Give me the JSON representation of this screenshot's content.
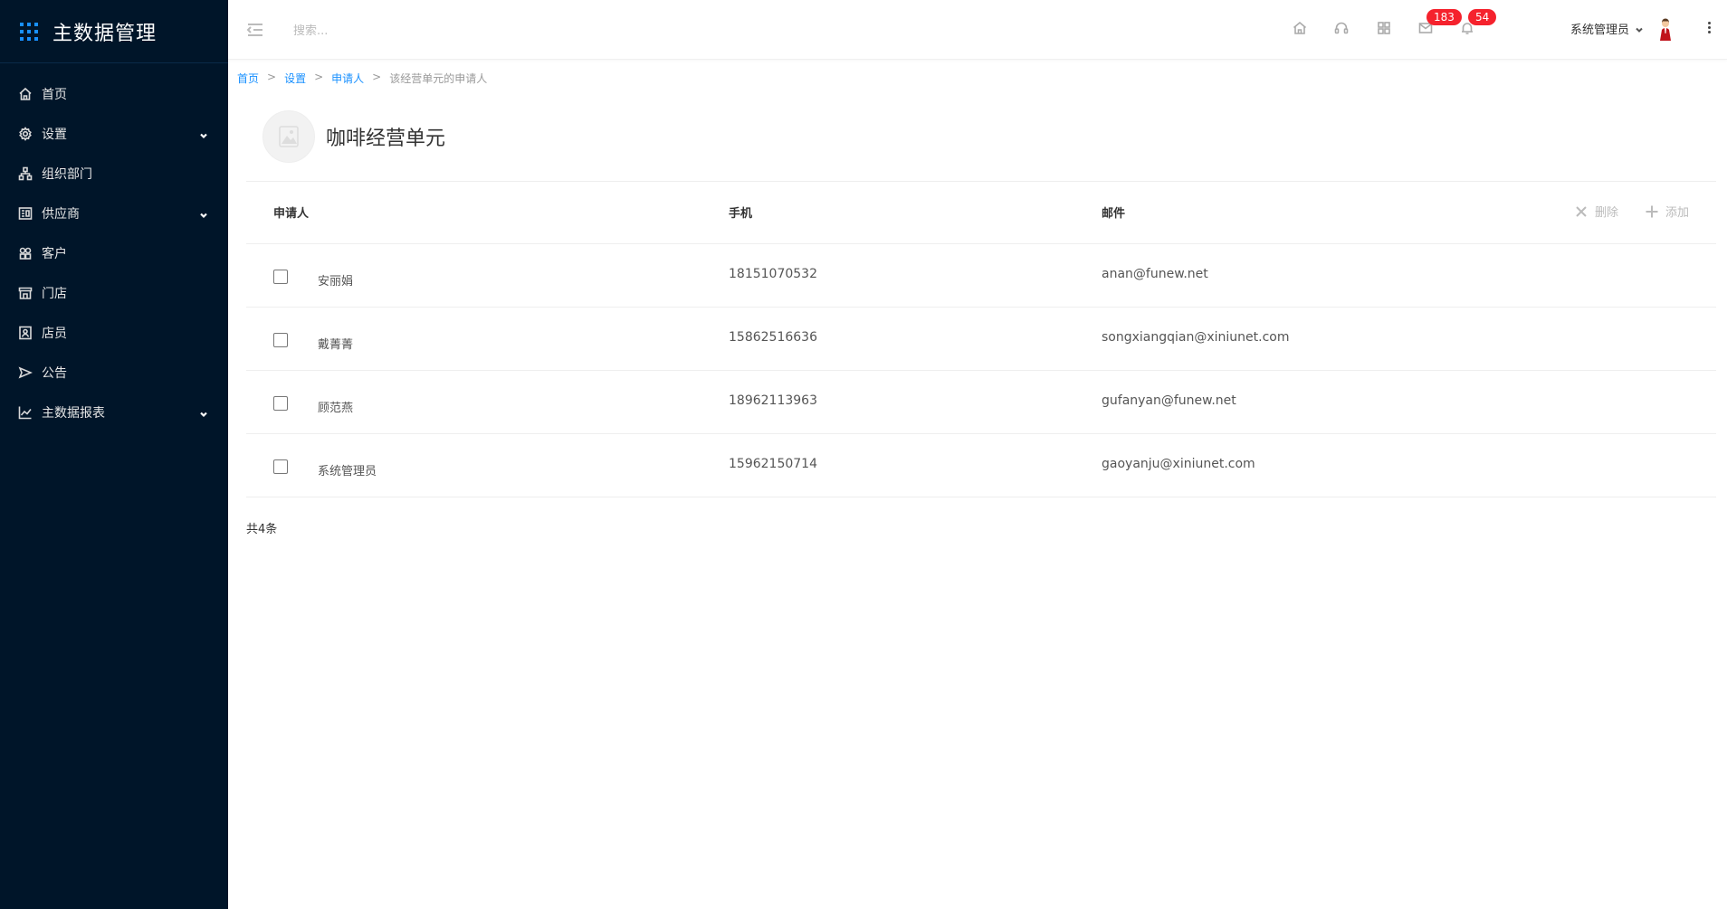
{
  "app": {
    "title": "主数据管理"
  },
  "sidebar": {
    "items": [
      {
        "label": "首页",
        "icon": "home-icon",
        "has_children": false
      },
      {
        "label": "设置",
        "icon": "gear-icon",
        "has_children": true
      },
      {
        "label": "组织部门",
        "icon": "org-tree-icon",
        "has_children": false
      },
      {
        "label": "供应商",
        "icon": "supplier-icon",
        "has_children": true
      },
      {
        "label": "客户",
        "icon": "customer-icon",
        "has_children": false
      },
      {
        "label": "门店",
        "icon": "store-icon",
        "has_children": false
      },
      {
        "label": "店员",
        "icon": "staff-icon",
        "has_children": false
      },
      {
        "label": "公告",
        "icon": "announcement-icon",
        "has_children": false
      },
      {
        "label": "主数据报表",
        "icon": "chart-icon",
        "has_children": true
      }
    ]
  },
  "header": {
    "search_placeholder": "搜索...",
    "icons": [
      "home-icon",
      "headset-icon",
      "apps-icon",
      "mail-icon",
      "bell-icon"
    ],
    "mail_badge": "183",
    "bell_badge": "54",
    "user_name": "系统管理员"
  },
  "breadcrumb": {
    "items": [
      "首页",
      "设置",
      "申请人"
    ],
    "current": "该经营单元的申请人",
    "separator": ">"
  },
  "page": {
    "title": "咖啡经营单元"
  },
  "table": {
    "columns": [
      "申请人",
      "手机",
      "邮件"
    ],
    "actions": {
      "delete": "删除",
      "add": "添加"
    },
    "rows": [
      {
        "name": "安丽娟",
        "phone": "18151070532",
        "email": "anan@funew.net"
      },
      {
        "name": "戴菁菁",
        "phone": "15862516636",
        "email": "songxiangqian@xiniunet.com"
      },
      {
        "name": "顾范燕",
        "phone": "18962113963",
        "email": "gufanyan@funew.net"
      },
      {
        "name": "系统管理员",
        "phone": "15962150714",
        "email": "gaoyanju@xiniunet.com"
      }
    ]
  },
  "footer": {
    "total": "共4条"
  },
  "colors": {
    "sidebar_bg": "#001529",
    "accent": "#1890ff",
    "badge": "#f5222d"
  }
}
